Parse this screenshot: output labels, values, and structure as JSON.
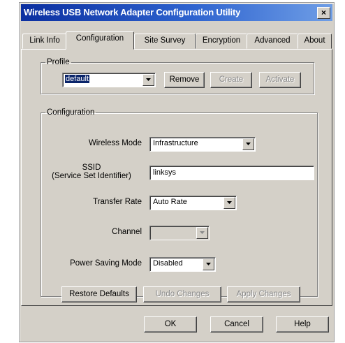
{
  "window": {
    "title": "Wireless USB Network Adapter Configuration Utility",
    "close": "×"
  },
  "tabs": [
    "Link Info",
    "Configuration",
    "Site Survey",
    "Encryption",
    "Advanced",
    "About"
  ],
  "profile": {
    "legend": "Profile",
    "selected": "default",
    "remove": "Remove",
    "create": "Create",
    "activate": "Activate"
  },
  "config": {
    "legend": "Configuration",
    "wireless_mode_label": "Wireless Mode",
    "wireless_mode_value": "Infrastructure",
    "ssid_label": "SSID",
    "ssid_sublabel": "(Service Set Identifier)",
    "ssid_value": "linksys",
    "transfer_rate_label": "Transfer Rate",
    "transfer_rate_value": "Auto Rate",
    "channel_label": "Channel",
    "channel_value": "",
    "power_saving_label": "Power Saving Mode",
    "power_saving_value": "Disabled",
    "restore_defaults": "Restore Defaults",
    "undo_changes": "Undo Changes",
    "apply_changes": "Apply Changes"
  },
  "footer": {
    "ok": "OK",
    "cancel": "Cancel",
    "help": "Help"
  },
  "icons": {
    "dropdown": "chevron-down-icon",
    "close": "close-icon"
  }
}
